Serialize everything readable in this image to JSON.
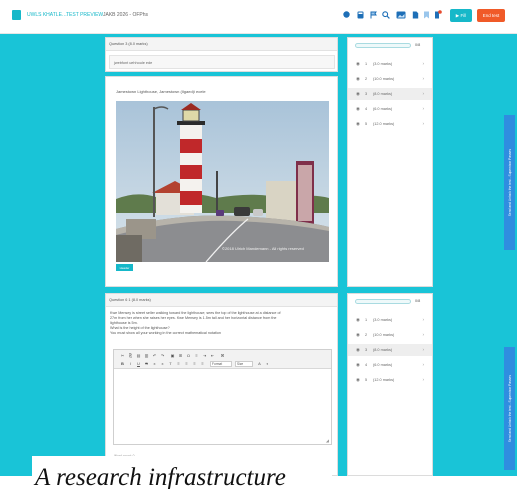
{
  "topbar": {
    "crumb_1": "UWLS KHATLE…",
    "crumb_2": "TEST PREVIEW",
    "crumb_3": "JAKB 2026 - OFPhs",
    "notification_count": "1",
    "save_label": "▶ Fill",
    "exit_label": "End test",
    "colors": {
      "accent": "#16b8c9",
      "exit": "#f05a28",
      "icon": "#1e6fb7"
    }
  },
  "question_1": {
    "header": "Question 3  (8.0 marks)",
    "answer_text": "jwebfont uehhoule ede",
    "prompt": "Jamestown Lighthouse, Jamestown (Ilgaed)i ecele",
    "photo_credit": "©2018 Ulrich Mandemann - All rights reserved",
    "badge": "Header"
  },
  "question_2": {
    "header": "Question 6 1  (8.0 marks)",
    "body_lines": [
      "Kwe Mensey is street seller walking toward the lighthouse; sees the top of the lighthouse at a distance of",
      "27m from her when she raises her eyes. Kwe Mensey is 1.5m tall and her horizontal distance from the",
      "lighthouse is 5m.",
      "What is the height of the lighthouse?",
      "You must show all your working in the correct mathematical notation"
    ],
    "format_label": "Format",
    "size_label": "Size",
    "word_count": "Word count: 0"
  },
  "nav_top": {
    "progress_count": "0/8",
    "progress_fraction": 0,
    "items": [
      {
        "num": "1",
        "marks": "(3.0 marks)",
        "active": false
      },
      {
        "num": "2",
        "marks": "(10.0 marks)",
        "active": false
      },
      {
        "num": "3",
        "marks": "(8.0 marks)",
        "active": true
      },
      {
        "num": "4",
        "marks": "(6.0 marks)",
        "active": false
      },
      {
        "num": "5",
        "marks": "(12.0 marks)",
        "active": false
      }
    ],
    "side_tab": "Send and Unlock the test - Supervisor Passes"
  },
  "nav_bottom": {
    "progress_count": "0/8",
    "progress_fraction": 0,
    "items": [
      {
        "num": "1",
        "marks": "(3.0 marks)",
        "active": false
      },
      {
        "num": "2",
        "marks": "(10.0 marks)",
        "active": false
      },
      {
        "num": "3",
        "marks": "(8.0 marks)",
        "active": true
      },
      {
        "num": "4",
        "marks": "(6.0 marks)",
        "active": false
      },
      {
        "num": "5",
        "marks": "(12.0 marks)",
        "active": false
      }
    ],
    "side_tab": "Send and Unlock the test - Supervisor Passes"
  },
  "caption": "A research infrastructure"
}
